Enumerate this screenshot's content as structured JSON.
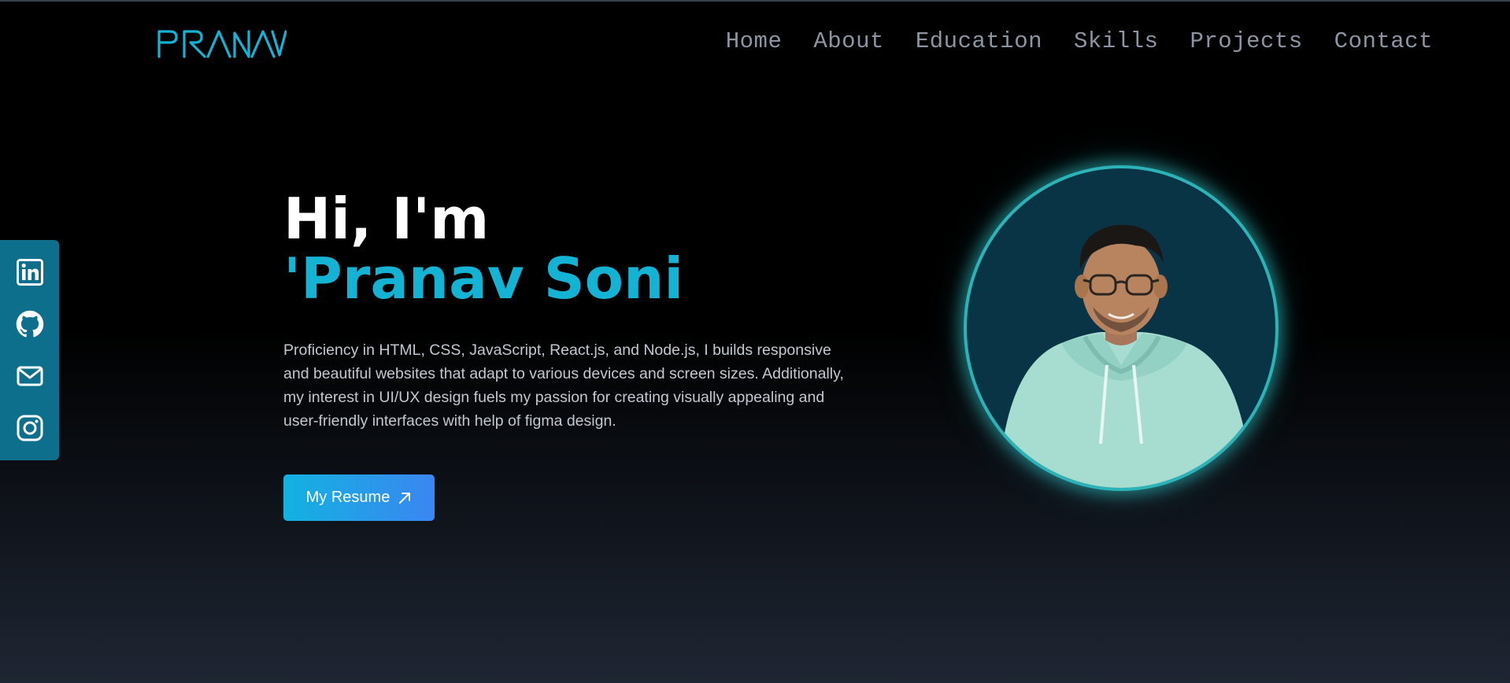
{
  "brand": {
    "logo_text": "PRANAV",
    "accent_color": "#14b3d4"
  },
  "nav": {
    "items": [
      {
        "label": "Home"
      },
      {
        "label": "About"
      },
      {
        "label": "Education"
      },
      {
        "label": "Skills"
      },
      {
        "label": "Projects"
      },
      {
        "label": "Contact"
      }
    ]
  },
  "social": {
    "icons": [
      "linkedin-icon",
      "github-icon",
      "mail-icon",
      "instagram-icon"
    ],
    "bar_color": "#0e6f8c"
  },
  "hero": {
    "greeting": "Hi, I'm",
    "name": "'Pranav Soni",
    "description": "Proficiency in HTML, CSS, JavaScript, React.js, and Node.js, I builds responsive and beautiful websites that adapt to various devices and screen sizes. Additionally, my interest in UI/UX design fuels my passion for creating visually appealing and user-friendly interfaces with help of figma design.",
    "resume_button": {
      "label": "My Resume",
      "icon": "arrow-up-right-icon"
    }
  },
  "portrait": {
    "ring_color": "#2bb3b8",
    "background_color": "#083446"
  }
}
